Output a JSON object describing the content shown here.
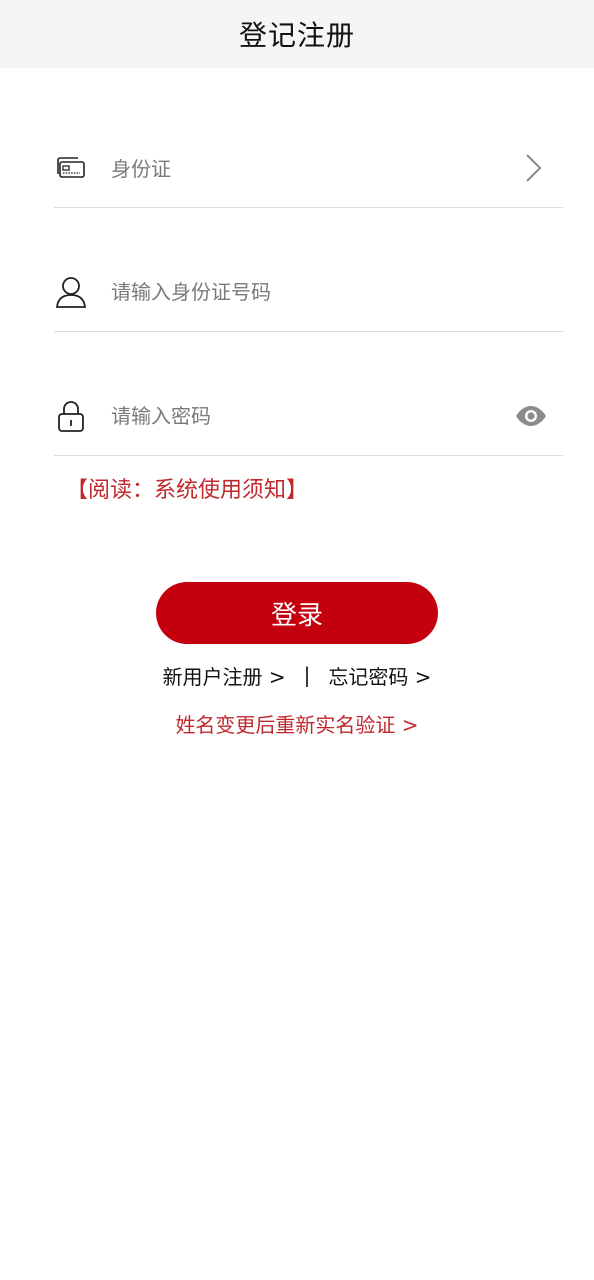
{
  "header": {
    "title": "登记注册"
  },
  "form": {
    "id_type": {
      "label": "身份证",
      "icon": "id-card-icon",
      "right_icon": "chevron-right-icon"
    },
    "id_number": {
      "placeholder": "请输入身份证号码",
      "value": "",
      "icon": "user-icon"
    },
    "password": {
      "placeholder": "请输入密码",
      "value": "",
      "icon": "lock-icon",
      "right_icon": "eye-icon"
    }
  },
  "notice": {
    "text": "【阅读：系统使用须知】",
    "color": "#c0282d"
  },
  "actions": {
    "login_label": "登录",
    "login_color": "#c4000f",
    "register_label": "新用户注册 >",
    "separator": "|",
    "forgot_label": "忘记密码 >",
    "reverify_label": "姓名变更后重新实名验证 >"
  }
}
